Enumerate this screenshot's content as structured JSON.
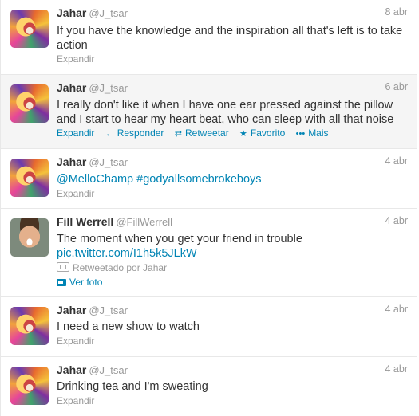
{
  "labels": {
    "expand": "Expandir",
    "reply": "Responder",
    "retweet": "Retweetar",
    "favorite": "Favorito",
    "more": "Mais",
    "view_photo": "Ver foto"
  },
  "icons": {
    "reply": "reply-arrow-icon",
    "retweet": "retweet-icon",
    "favorite": "star-icon",
    "more": "more-dots-icon",
    "retweeted": "retweeted-icon",
    "photo": "photo-icon"
  },
  "colors": {
    "link": "#0084b4",
    "muted": "#999999",
    "text": "#333333",
    "hover_bg": "#f5f5f5"
  },
  "tweets": [
    {
      "name": "Jahar",
      "handle": "@J_tsar",
      "time": "8 abr",
      "text_line1": "If you have the knowledge and the inspiration all that's left is to take",
      "text_line2": "action"
    },
    {
      "name": "Jahar",
      "handle": "@J_tsar",
      "time": "6 abr",
      "text_line1": "I really don't like it when I have one ear pressed against the pillow",
      "text_line2": "and I start to hear my heart beat, who can sleep with all that noise"
    },
    {
      "name": "Jahar",
      "handle": "@J_tsar",
      "time": "4 abr",
      "mention": "@MelloChamp",
      "hashtag": "#godyallsomebrokeboys"
    },
    {
      "name": "Fill Werrell",
      "handle": "@FillWerrell",
      "time": "4 abr",
      "text_line1": "The moment when you get your friend in trouble",
      "link": "pic.twitter.com/I1h5k5JLkW",
      "retweeted_by": "Retweetado por Jahar"
    },
    {
      "name": "Jahar",
      "handle": "@J_tsar",
      "time": "4 abr",
      "text_line1": "I need a new show to watch"
    },
    {
      "name": "Jahar",
      "handle": "@J_tsar",
      "time": "4 abr",
      "text_line1": "Drinking tea and I'm sweating"
    }
  ]
}
